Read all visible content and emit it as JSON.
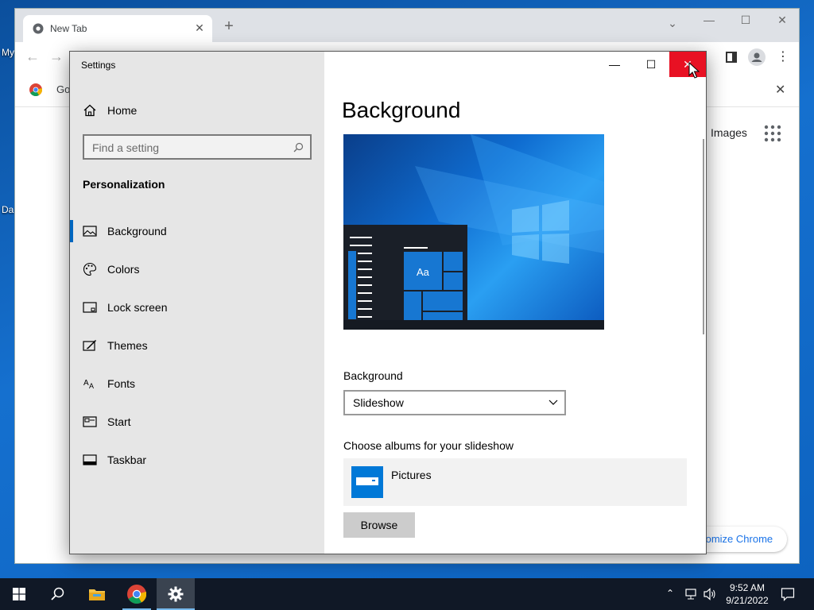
{
  "desktop": {
    "icon_label_1": "My",
    "icon_label_2": "Da"
  },
  "chrome": {
    "tab_title": "New Tab",
    "bookmark_text": "Go",
    "images_link": "Images",
    "customize_label": "tomize Chrome"
  },
  "settings": {
    "window_title": "Settings",
    "home_label": "Home",
    "search_placeholder": "Find a setting",
    "section_title": "Personalization",
    "nav_items": [
      {
        "label": "Background",
        "icon": "picture-icon",
        "active": true
      },
      {
        "label": "Colors",
        "icon": "palette-icon"
      },
      {
        "label": "Lock screen",
        "icon": "lock-screen-icon"
      },
      {
        "label": "Themes",
        "icon": "themes-icon"
      },
      {
        "label": "Fonts",
        "icon": "fonts-icon"
      },
      {
        "label": "Start",
        "icon": "start-icon"
      },
      {
        "label": "Taskbar",
        "icon": "taskbar-icon"
      }
    ],
    "page_heading": "Background",
    "preview_tile_text": "Aa",
    "background_label": "Background",
    "background_value": "Slideshow",
    "albums_label": "Choose albums for your slideshow",
    "album_name": "Pictures",
    "browse_label": "Browse"
  },
  "taskbar": {
    "time": "9:52 AM",
    "date": "9/21/2022"
  },
  "colors": {
    "accent": "#0078d7",
    "close_red": "#e81123",
    "taskbar": "#101826"
  }
}
